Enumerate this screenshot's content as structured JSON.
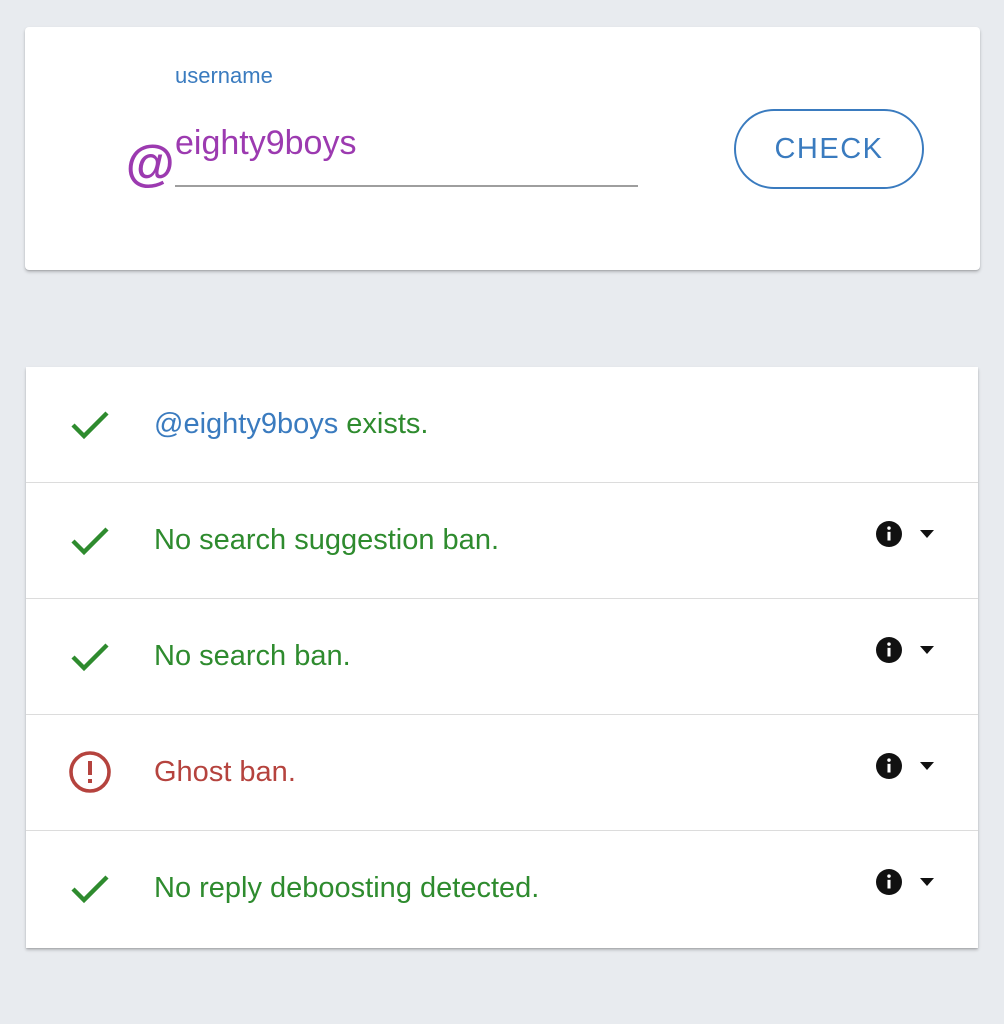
{
  "colors": {
    "background": "#e8ebef",
    "accent_purple": "#9c3ab0",
    "accent_blue": "#3a7bbf",
    "success_green": "#2e8b2e",
    "error_red": "#b5433e",
    "info_black": "#111111"
  },
  "search": {
    "at_symbol": "@",
    "label": "username",
    "value": "eighty9boys",
    "placeholder": "",
    "check_button": "CHECK"
  },
  "results": {
    "exists": {
      "icon": "check-icon",
      "handle": "@eighty9boys",
      "text": " exists."
    },
    "items": [
      {
        "icon": "check-icon",
        "status": "ok",
        "text": "No search suggestion ban.",
        "info_icon": "info-icon",
        "toggle_icon": "chevron-down-icon"
      },
      {
        "icon": "check-icon",
        "status": "ok",
        "text": "No search ban.",
        "info_icon": "info-icon",
        "toggle_icon": "chevron-down-icon"
      },
      {
        "icon": "alert-circle-icon",
        "status": "ban",
        "text": "Ghost ban.",
        "info_icon": "info-icon",
        "toggle_icon": "chevron-down-icon"
      },
      {
        "icon": "check-icon",
        "status": "ok",
        "text": "No reply deboosting detected.",
        "info_icon": "info-icon",
        "toggle_icon": "chevron-down-icon"
      }
    ]
  }
}
